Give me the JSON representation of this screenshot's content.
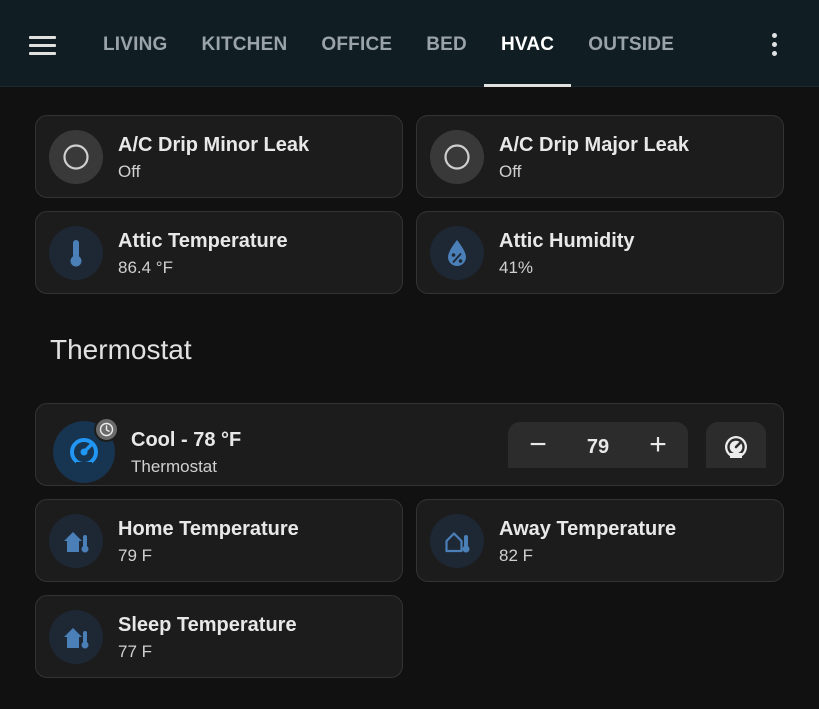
{
  "header": {
    "tabs": [
      {
        "label": "LIVING"
      },
      {
        "label": "KITCHEN"
      },
      {
        "label": "OFFICE"
      },
      {
        "label": "BED"
      },
      {
        "label": "HVAC",
        "active": true
      },
      {
        "label": "OUTSIDE"
      }
    ],
    "menu_icon": "hamburger-menu-icon",
    "overflow_icon": "dots-vertical-icon"
  },
  "tiles": {
    "minor_leak": {
      "name": "A/C Drip Minor Leak",
      "state": "Off",
      "icon": "circle-outline-icon"
    },
    "major_leak": {
      "name": "A/C Drip Major Leak",
      "state": "Off",
      "icon": "circle-outline-icon"
    },
    "attic_temp": {
      "name": "Attic Temperature",
      "state": "86.4 °F",
      "icon": "thermometer-icon"
    },
    "attic_humidity": {
      "name": "Attic Humidity",
      "state": "41%",
      "icon": "water-percent-icon"
    }
  },
  "section": {
    "title": "Thermostat"
  },
  "thermostat": {
    "title": "Cool - 78 °F",
    "subtitle": "Thermostat",
    "target": "79",
    "minus": "−",
    "plus": "+",
    "icon": "thermostat-cool-icon",
    "badge_icon": "clock-icon",
    "mode_icon": "thermostat-mode-icon"
  },
  "presets": {
    "home": {
      "name": "Home Temperature",
      "state": "79 F",
      "icon": "home-thermometer-icon"
    },
    "away": {
      "name": "Away Temperature",
      "state": "82 F",
      "icon": "home-thermometer-outline-icon"
    },
    "sleep": {
      "name": "Sleep Temperature",
      "state": "77 F",
      "icon": "home-thermometer-icon"
    }
  },
  "colors": {
    "background": "#111111",
    "header": "#101e24",
    "card": "#1c1c1c",
    "accent_blue": "#2196f3",
    "icon_blue": "#4a7fb8"
  }
}
